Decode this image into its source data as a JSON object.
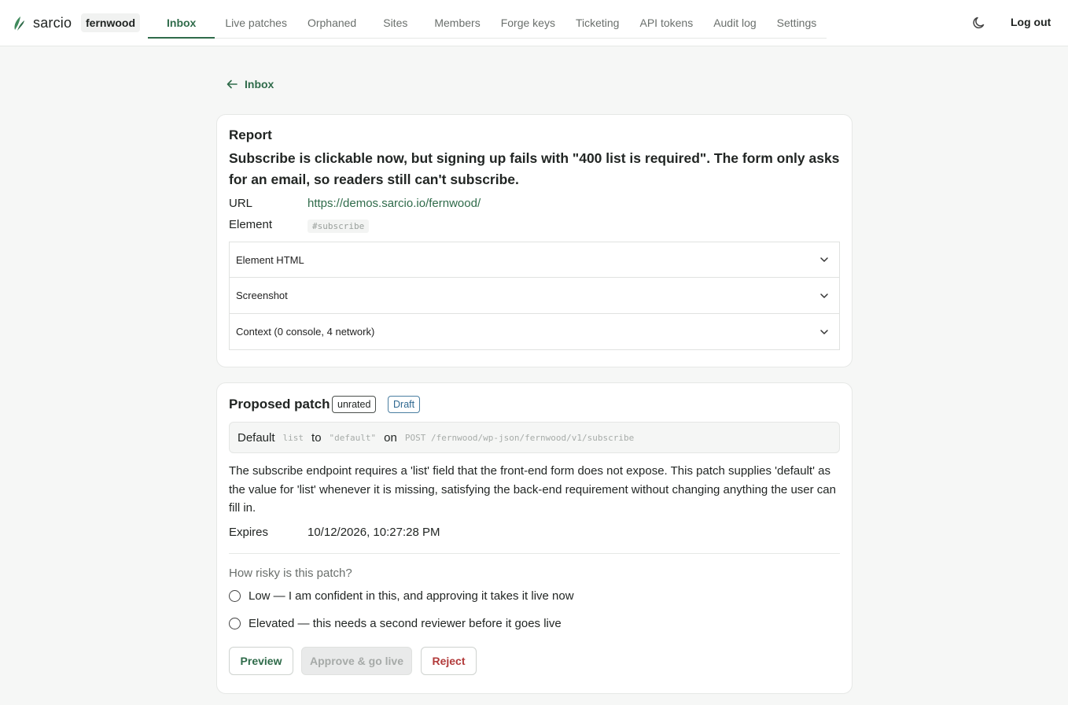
{
  "app": {
    "brand": "sarcio",
    "workspace": "fernwood",
    "logout_label": "Log out",
    "accent_color": "#2f6b4a"
  },
  "nav": {
    "tabs": [
      {
        "label": "Inbox",
        "active": true
      },
      {
        "label": "Live patches"
      },
      {
        "label": "Orphaned"
      },
      {
        "label": "Sites"
      },
      {
        "label": "Members"
      },
      {
        "label": "Forge keys"
      },
      {
        "label": "Ticketing"
      },
      {
        "label": "API tokens"
      },
      {
        "label": "Audit log"
      },
      {
        "label": "Settings"
      }
    ]
  },
  "back": {
    "label": "Inbox"
  },
  "report": {
    "title": "Report",
    "text": "Subscribe is clickable now, but signing up fails with \"400 list is required\". The form only asks for an email, so readers still can't subscribe.",
    "url_label": "URL",
    "url_value": "https://demos.sarcio.io/fernwood/",
    "element_label": "Element",
    "element_value": "#subscribe",
    "sections": [
      {
        "label": "Element HTML"
      },
      {
        "label": "Screenshot"
      },
      {
        "label": "Context (0 console, 4 network)"
      }
    ]
  },
  "patch": {
    "title": "Proposed patch",
    "rating_badge": "unrated",
    "status_badge": "Draft",
    "summary": {
      "w1": "Default",
      "field": "list",
      "w2": "to",
      "value": "\"default\"",
      "w3": "on",
      "endpoint": "POST /fernwood/wp-json/fernwood/v1/subscribe"
    },
    "description": "The subscribe endpoint requires a 'list' field that the front-end form does not expose. This patch supplies 'default' as the value for 'list' whenever it is missing, satisfying the back-end requirement without changing anything the user can fill in.",
    "expires_label": "Expires",
    "expires_value": "10/12/2026, 10:27:28 PM",
    "risk_question": "How risky is this patch?",
    "risk_options": [
      "Low — I am confident in this, and approving it takes it live now",
      "Elevated — this needs a second reviewer before it goes live"
    ],
    "buttons": {
      "preview": "Preview",
      "approve": "Approve & go live",
      "reject": "Reject"
    }
  }
}
